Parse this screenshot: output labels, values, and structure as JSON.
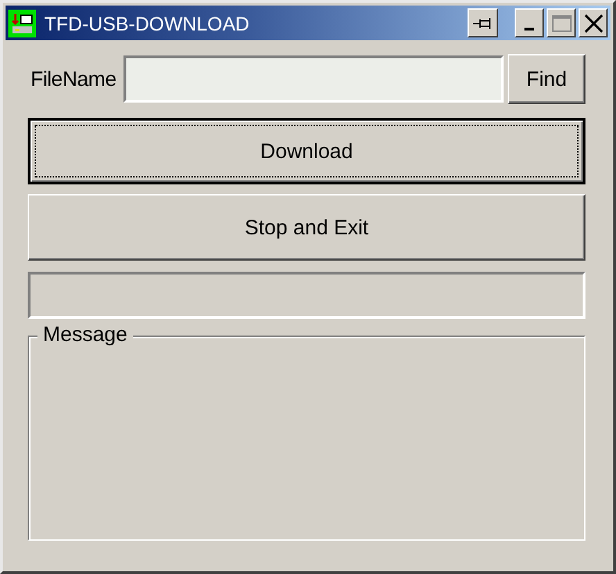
{
  "window": {
    "title": "TFD-USB-DOWNLOAD"
  },
  "file": {
    "label": "FileName",
    "button": "Find"
  },
  "buttons": [
    {
      "label": "Download",
      "focused": true
    },
    {
      "label": "Stop and Exit",
      "focused": false
    }
  ],
  "progress": {
    "level": 0
  },
  "message": {
    "title": "Message"
  }
}
